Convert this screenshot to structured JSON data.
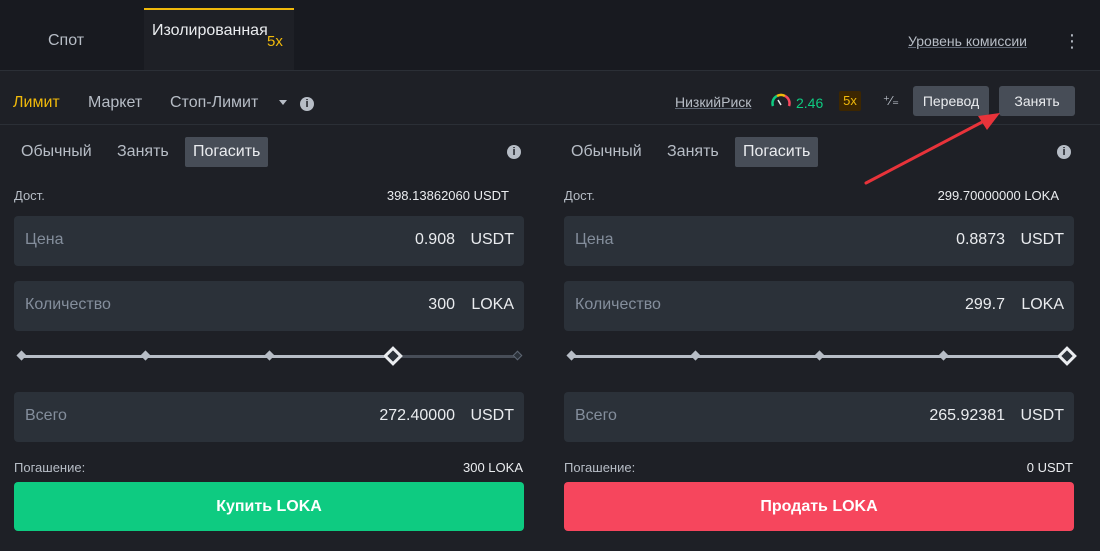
{
  "tabs": {
    "spot": "Спот",
    "isolated": "Изолированная",
    "isolated_leverage": "5x",
    "fee_level": "Уровень комиссии",
    "more_icon": "vertical-ellipsis"
  },
  "order_types": {
    "limit": "Лимит",
    "market": "Маркет",
    "stop_limit": "Стоп-Лимит"
  },
  "risk": {
    "label": "НизкийРиск",
    "value": "2.46",
    "leverage": "5x",
    "value_color": "#0ecb81"
  },
  "actions": {
    "transfer": "Перевод",
    "borrow": "Занять"
  },
  "buy_panel": {
    "modes": [
      "Обычный",
      "Занять",
      "Погасить"
    ],
    "active_mode": "Погасить",
    "available_label": "Дост.",
    "available_value": "398.13862060 USDT",
    "price_label": "Цена",
    "price_value": "0.908",
    "price_unit": "USDT",
    "qty_label": "Количество",
    "qty_value": "300",
    "qty_unit": "LOKA",
    "slider_percent": 75,
    "total_label": "Всего",
    "total_value": "272.40000",
    "total_unit": "USDT",
    "repay_label": "Погашение:",
    "repay_value": "300 LOKA",
    "submit": "Купить LOKA",
    "submit_color": "#0ecb81"
  },
  "sell_panel": {
    "modes": [
      "Обычный",
      "Занять",
      "Погасить"
    ],
    "active_mode": "Погасить",
    "available_label": "Дост.",
    "available_value": "299.70000000 LOKA",
    "price_label": "Цена",
    "price_value": "0.8873",
    "price_unit": "USDT",
    "qty_label": "Количество",
    "qty_value": "299.7",
    "qty_unit": "LOKA",
    "slider_percent": 100,
    "total_label": "Всего",
    "total_value": "265.92381",
    "total_unit": "USDT",
    "repay_label": "Погашение:",
    "repay_value": "0 USDT",
    "submit": "Продать LOKA",
    "submit_color": "#f6465d"
  },
  "accent_color": "#f0b90b",
  "annotation_arrow_color": "#e8333a"
}
